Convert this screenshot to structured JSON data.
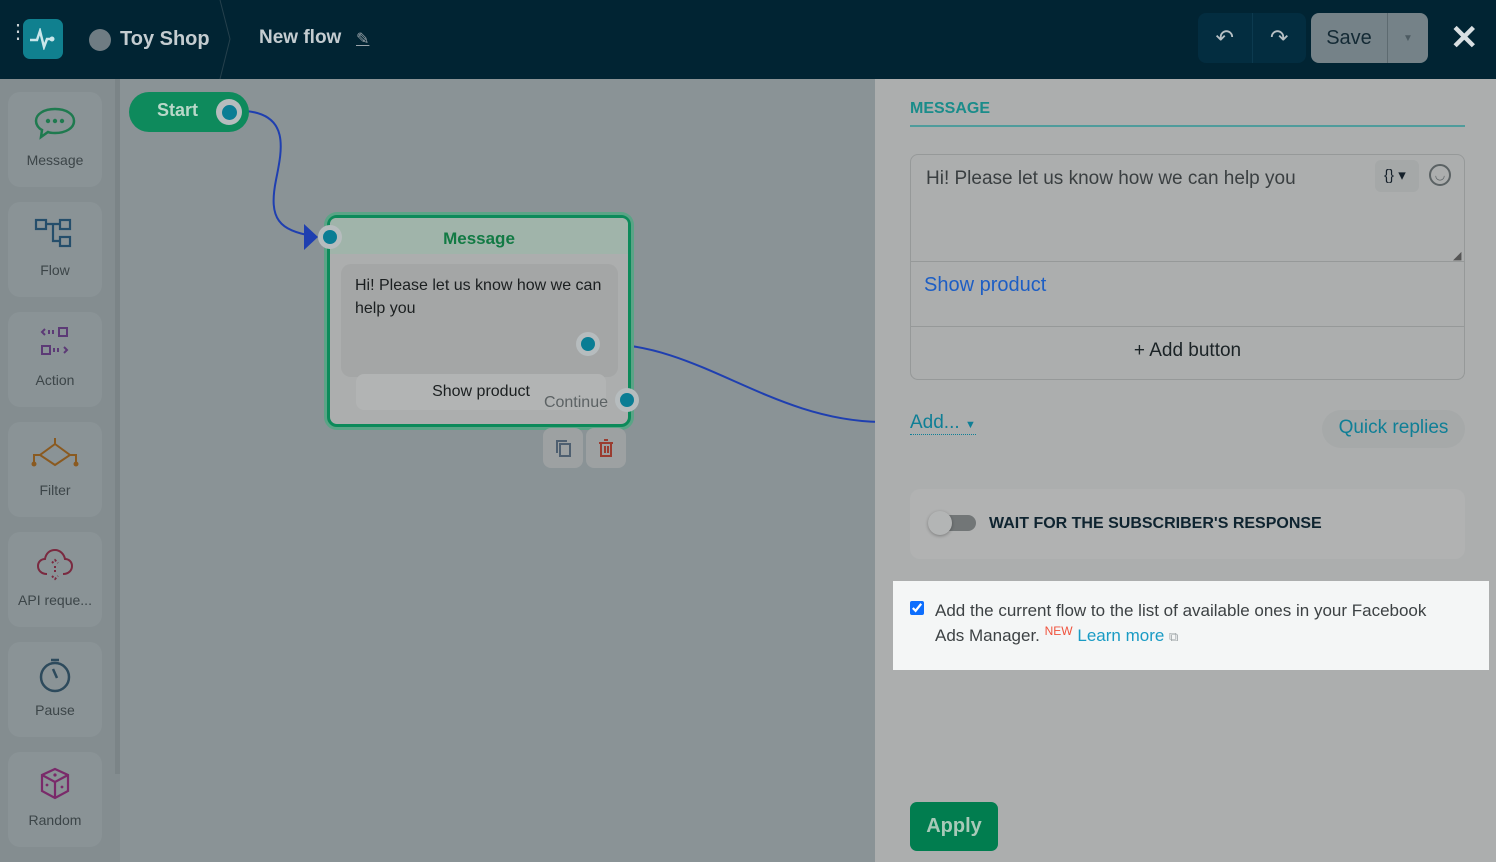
{
  "header": {
    "shop_name": "Toy Shop",
    "flow_name": "New flow",
    "save_label": "Save"
  },
  "sidebar": {
    "items": [
      {
        "label": "Message",
        "icon": "chat-bubble-icon"
      },
      {
        "label": "Flow",
        "icon": "flow-icon"
      },
      {
        "label": "Action",
        "icon": "action-icon"
      },
      {
        "label": "Filter",
        "icon": "filter-icon"
      },
      {
        "label": "API reque...",
        "icon": "cloud-api-icon"
      },
      {
        "label": "Pause",
        "icon": "stopwatch-icon"
      },
      {
        "label": "Random",
        "icon": "dice-icon"
      }
    ]
  },
  "canvas": {
    "start_label": "Start",
    "node": {
      "title": "Message",
      "text": "Hi! Please let us know how we can help you",
      "button": "Show product",
      "continue": "Continue"
    }
  },
  "panel": {
    "title": "MESSAGE",
    "message_text": "Hi! Please let us know how we can help you",
    "variable_icon": "{}",
    "quick_button": "Show product",
    "add_button": "+ Add button",
    "add_menu": "Add...",
    "quick_replies": "Quick replies",
    "wait_label": "WAIT FOR THE SUBSCRIBER'S RESPONSE",
    "wait_enabled": false,
    "ads_checkbox": {
      "checked": true,
      "text": "Add the current flow to the list of available ones in your Facebook Ads Manager.",
      "badge": "NEW",
      "link": "Learn more"
    },
    "apply": "Apply"
  },
  "colors": {
    "header": "#012433",
    "accent": "#0e8a5c",
    "link": "#199bc4",
    "badge": "#f0533e"
  }
}
